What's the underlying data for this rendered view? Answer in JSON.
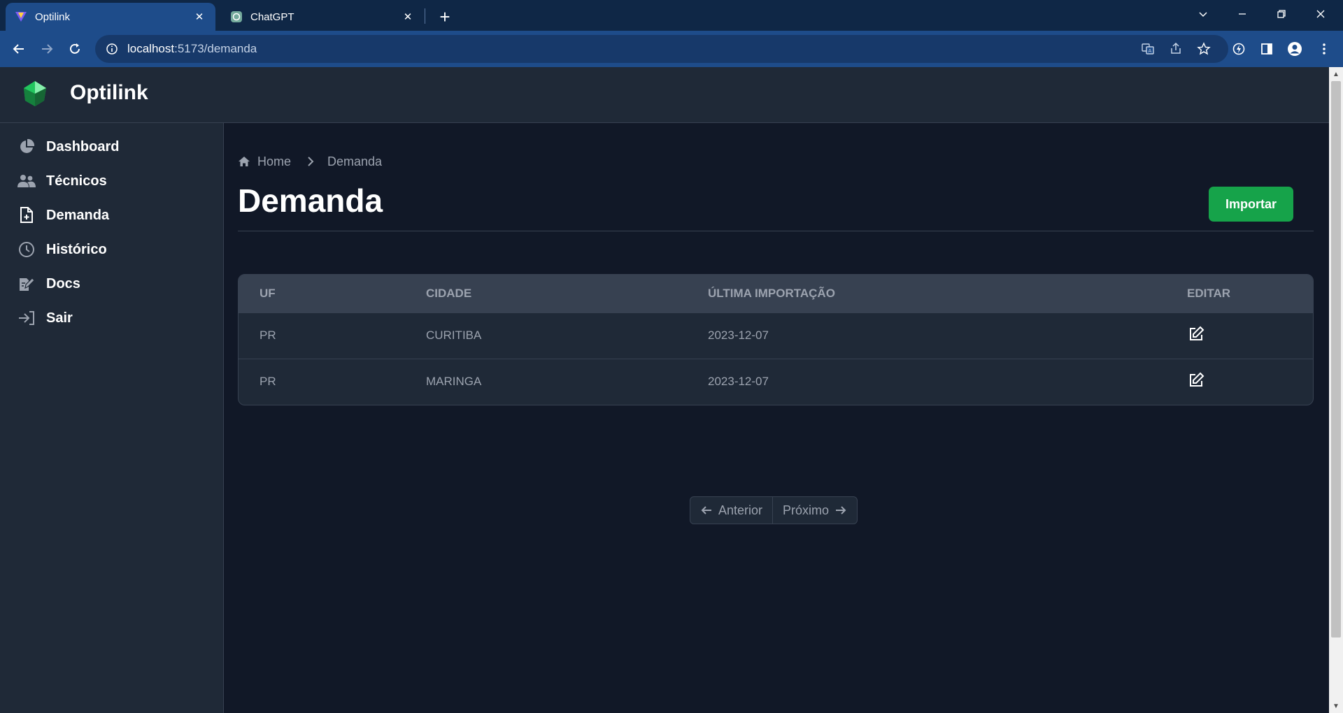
{
  "browser": {
    "tabs": [
      {
        "title": "Optilink",
        "active": true,
        "icon": "optilink-favicon"
      },
      {
        "title": "ChatGPT",
        "active": false,
        "icon": "chatgpt-favicon"
      }
    ],
    "url_host": "localhost",
    "url_rest": ":5173/demanda"
  },
  "app": {
    "brand": "Optilink",
    "sidebar": {
      "items": [
        {
          "label": "Dashboard",
          "icon": "pie-chart-icon"
        },
        {
          "label": "Técnicos",
          "icon": "users-icon"
        },
        {
          "label": "Demanda",
          "icon": "file-plus-icon"
        },
        {
          "label": "Histórico",
          "icon": "clock-icon"
        },
        {
          "label": "Docs",
          "icon": "edit-doc-icon"
        },
        {
          "label": "Sair",
          "icon": "sign-in-icon"
        }
      ]
    },
    "breadcrumb": {
      "home": "Home",
      "current": "Demanda"
    },
    "page_title": "Demanda",
    "import_label": "Importar",
    "table": {
      "headers": {
        "uf": "UF",
        "cidade": "CIDADE",
        "ultima_importacao": "ÚLTIMA IMPORTAÇÃO",
        "editar": "EDITAR"
      },
      "rows": [
        {
          "uf": "PR",
          "cidade": "CURITIBA",
          "ultima_importacao": "2023-12-07"
        },
        {
          "uf": "PR",
          "cidade": "MARINGA",
          "ultima_importacao": "2023-12-07"
        }
      ]
    },
    "pagination": {
      "prev": "Anterior",
      "next": "Próximo"
    },
    "colors": {
      "accent": "#16a34a",
      "background": "#111827",
      "panel": "#1f2937",
      "border": "#374151",
      "muted_text": "#9ca3af"
    }
  }
}
